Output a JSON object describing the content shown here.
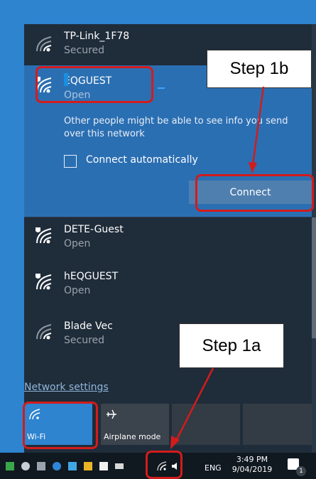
{
  "networks": [
    {
      "name": "TP-Link_1F78",
      "status": "Secured",
      "icon": "wifi-icon"
    },
    {
      "name": "EQGUEST",
      "status": "Open",
      "icon": "wifi-shield-icon",
      "selected": true
    },
    {
      "name": "DETE-Guest",
      "status": "Open",
      "icon": "wifi-shield-icon"
    },
    {
      "name": "hEQGUEST",
      "status": "Open",
      "icon": "wifi-shield-icon"
    },
    {
      "name": "Blade Vec",
      "status": "Secured",
      "icon": "wifi-icon"
    }
  ],
  "selected_panel": {
    "warning": "Other people might be able to see info you send over this network",
    "connect_automatically": "Connect automatically",
    "connect_button": "Connect"
  },
  "network_settings": "Network settings",
  "quick_actions": {
    "wifi": "Wi-Fi",
    "airplane": "Airplane mode"
  },
  "taskbar": {
    "language": "ENG",
    "time": "3:49 PM",
    "date": "9/04/2019",
    "notification_count": "1"
  },
  "callouts": {
    "step_1a": "Step 1a",
    "step_1b": "Step 1b"
  },
  "colors": {
    "panel": "#1f2c3a",
    "accent": "#2e84cf",
    "highlight": "#d21c1c"
  }
}
